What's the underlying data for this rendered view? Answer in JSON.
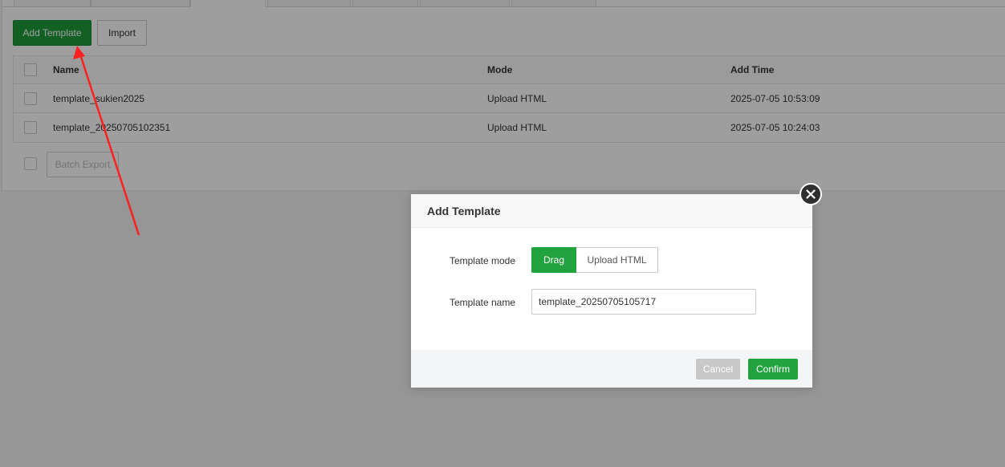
{
  "toolbar": {
    "add_template_label": "Add Template",
    "import_label": "Import"
  },
  "table": {
    "columns": [
      "Name",
      "Mode",
      "Add Time"
    ],
    "rows": [
      {
        "name": "template_sukien2025",
        "mode": "Upload HTML",
        "add_time": "2025-07-05 10:53:09"
      },
      {
        "name": "template_20250705102351",
        "mode": "Upload HTML",
        "add_time": "2025-07-05 10:24:03"
      }
    ]
  },
  "footer": {
    "batch_export_label": "Batch Export"
  },
  "dialog": {
    "title": "Add Template",
    "mode_label": "Template mode",
    "mode_options": [
      "Drag",
      "Upload HTML"
    ],
    "mode_selected": "Drag",
    "name_label": "Template name",
    "name_value": "template_20250705105717",
    "cancel_label": "Cancel",
    "confirm_label": "Confirm",
    "close_icon": "close-icon"
  },
  "colors": {
    "primary_green": "#209c3b",
    "annotation_arrow": "#ff2020",
    "overlay": "rgba(0,0,0,0.38)"
  }
}
